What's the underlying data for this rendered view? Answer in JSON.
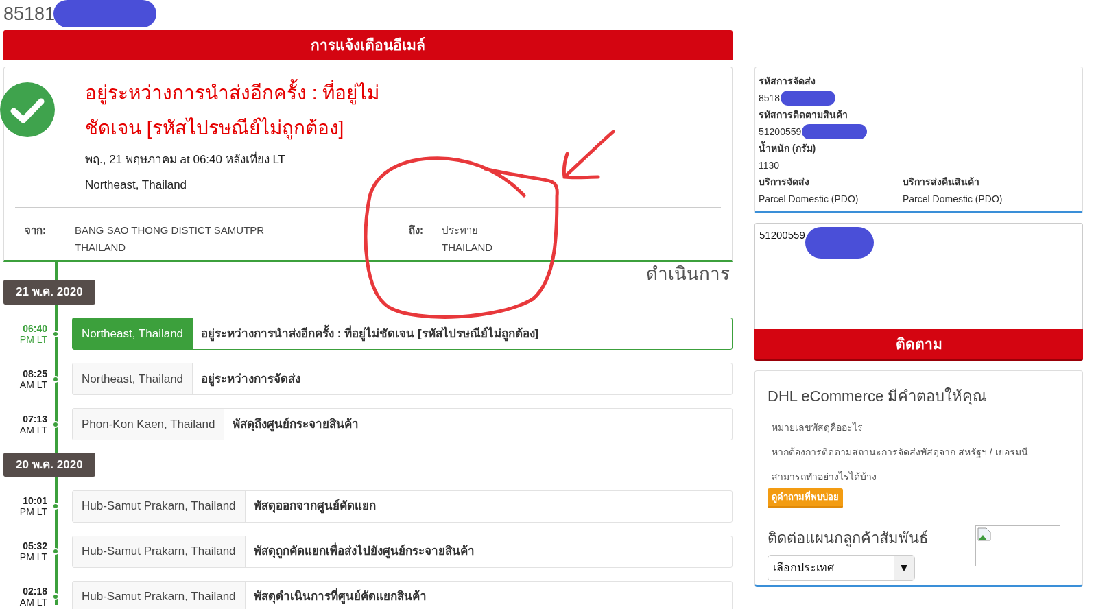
{
  "page_title": "85181",
  "alert_bar": "การแจ้งเตือนอีเมล์",
  "status_card": {
    "headline": "อยู่ระหว่างการนำส่งอีกครั้ง : ที่อยู่ไม่ชัดเจน [รหัสไปรษณีย์ไม่ถูกต้อง]",
    "datetime": "พฤ., 21 พฤษภาคม at 06:40 หลังเที่ยง LT",
    "location": "Northeast, Thailand",
    "from_label": "จาก:",
    "from_lines": [
      "BANG SAO THONG DISTICT SAMUTPR",
      "THAILAND"
    ],
    "to_label": "ถึง:",
    "to_lines": [
      "ประทาย",
      "THAILAND"
    ]
  },
  "progress_heading": "ดำเนินการ",
  "timeline": [
    {
      "date": "21 พ.ค. 2020",
      "events": [
        {
          "time": "06:40",
          "period": "PM LT",
          "location": "Northeast, Thailand",
          "status": "อยู่ระหว่างการนำส่งอีกครั้ง : ที่อยู่ไม่ชัดเจน [รหัสไปรษณีย์ไม่ถูกต้อง]",
          "selected": true
        },
        {
          "time": "08:25",
          "period": "AM LT",
          "location": "Northeast, Thailand",
          "status": "อยู่ระหว่างการจัดส่ง",
          "selected": false
        },
        {
          "time": "07:13",
          "period": "AM LT",
          "location": "Phon-Kon Kaen, Thailand",
          "status": "พัสดุถึงศูนย์กระจายสินค้า",
          "selected": false
        }
      ]
    },
    {
      "date": "20 พ.ค. 2020",
      "events": [
        {
          "time": "10:01",
          "period": "PM LT",
          "location": "Hub-Samut Prakarn, Thailand",
          "status": "พัสดุออกจากศูนย์คัดแยก",
          "selected": false
        },
        {
          "time": "05:32",
          "period": "PM LT",
          "location": "Hub-Samut Prakarn, Thailand",
          "status": "พัสดุถูกคัดแยกเพื่อส่งไปยังศูนย์กระจายสินค้า",
          "selected": false
        },
        {
          "time": "02:18",
          "period": "AM LT",
          "location": "Hub-Samut Prakarn, Thailand",
          "status": "พัสดุดำเนินการที่ศูนย์คัดแยกสินค้า",
          "selected": false
        }
      ]
    }
  ],
  "details": {
    "shipment_label": "รหัสการจัดส่ง",
    "shipment_value": "8518",
    "tracking_label": "รหัสการติดตามสินค้า",
    "tracking_value": "51200559",
    "weight_label": "น้ำหนัก (กรัม)",
    "weight_value": "1130",
    "service_label": "บริการจัดส่ง",
    "service_value": "Parcel Domestic (PDO)",
    "return_label": "บริการส่งคืนสินค้า",
    "return_value": "Parcel Domestic (PDO)"
  },
  "tracking_input": "51200559",
  "track_button": "ติดตาม",
  "help": {
    "title": "DHL eCommerce มีคำตอบให้คุณ",
    "links": [
      "หมายเลขพัสดุคืออะไร",
      "หากต้องการติดตามสถานะการจัดส่งพัสดุจาก สหรัฐฯ / เยอรมนี",
      "สามารถทำอย่างไรได้บ้าง"
    ],
    "faq_button": "ดูคำถามที่พบบ่อย",
    "contact_title": "ติดต่อแผนกลูกค้าสัมพันธ์",
    "country_select": "เลือกประเทศ"
  }
}
